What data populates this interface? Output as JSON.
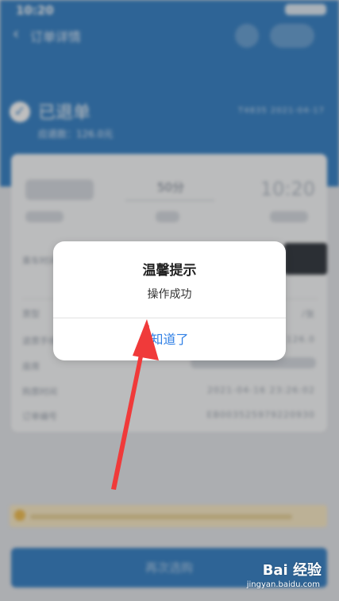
{
  "status": {
    "time": "10:20"
  },
  "nav": {
    "title": "订单详情"
  },
  "order": {
    "state": "已退单",
    "refund": "应退款：126.0元",
    "meta": "T4835   2021-04-17"
  },
  "trip": {
    "duration": "50分",
    "arrive_time": "10:20"
  },
  "rows": [
    {
      "label": "乘车时间",
      "value": ""
    },
    {
      "label": "票型",
      "value": "/张"
    },
    {
      "label": "退票手续费",
      "value": "126.0"
    },
    {
      "label": "座席",
      "value": ""
    },
    {
      "label": "购票时间",
      "value": "2021-04-16 23:26:02"
    },
    {
      "label": "订单编号",
      "value": "EB003525979220930"
    }
  ],
  "bottom_button": "再次选购",
  "dialog": {
    "title": "温馨提示",
    "message": "操作成功",
    "confirm": "知道了"
  },
  "watermark": {
    "brand": "Bai 经验",
    "url": "jingyan.baidu.com"
  },
  "colors": {
    "primary": "#3e86c8",
    "link": "#2f7fe5",
    "arrow": "#f03a3a"
  }
}
